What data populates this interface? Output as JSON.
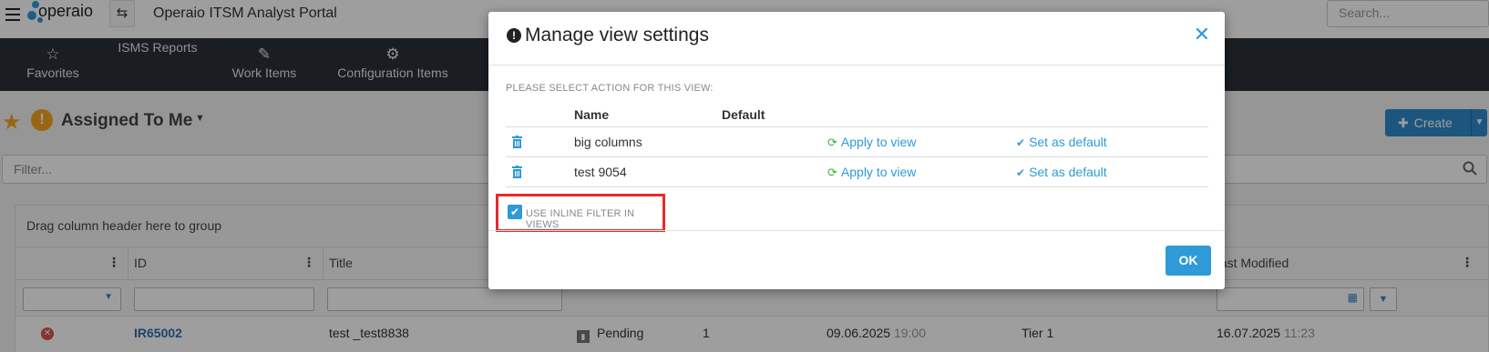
{
  "header": {
    "logo_text": "operaio",
    "portal_title": "Operaio ITSM Analyst Portal",
    "search_placeholder": "Search..."
  },
  "nav": {
    "items": [
      {
        "label": "Favorites",
        "icon": "star-outline-icon"
      },
      {
        "label": "ISMS Reports",
        "icon": ""
      },
      {
        "label": "Work Items",
        "icon": "edit-icon"
      },
      {
        "label": "Configuration Items",
        "icon": "cogs-icon"
      }
    ]
  },
  "page": {
    "view_title": "Assigned To Me",
    "create_label": "Create",
    "filter_placeholder": "Filter...",
    "group_hint": "Drag column header here to group"
  },
  "grid": {
    "columns": [
      "",
      "ID",
      "Title",
      "",
      "",
      "",
      "",
      "Last Modified"
    ],
    "row": {
      "id": "IR65002",
      "title": "test _test8838",
      "status": "Pending",
      "priority": "1",
      "date": "09.06.2025",
      "time": "19:00",
      "tier": "Tier 1",
      "modified_date": "16.07.2025",
      "modified_time": "11:23"
    }
  },
  "modal": {
    "title": "Manage view settings",
    "section_label": "PLEASE SELECT ACTION FOR THIS VIEW:",
    "col_name": "Name",
    "col_default": "Default",
    "rows": [
      {
        "name": "big columns",
        "apply_label": "Apply to view",
        "default_label": "Set as default"
      },
      {
        "name": "test 9054",
        "apply_label": "Apply to view",
        "default_label": "Set as default"
      }
    ],
    "inline_filter_label": "USE INLINE FILTER IN VIEWS",
    "inline_filter_checked": true,
    "ok_label": "OK"
  },
  "colors": {
    "accent": "#2e9ad8",
    "navbar": "#2b3138",
    "highlight": "#e32b2b",
    "refresh": "#3cb043"
  }
}
